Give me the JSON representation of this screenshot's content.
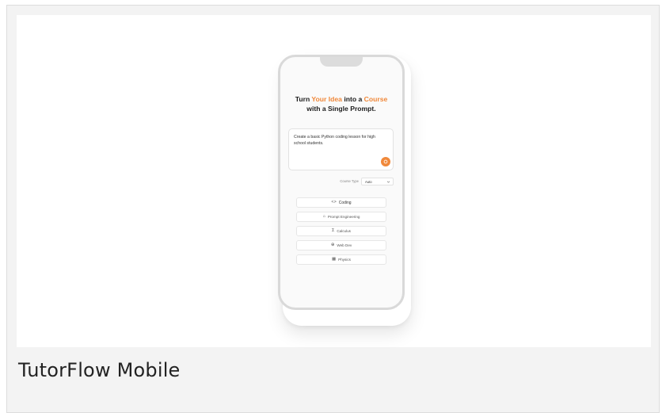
{
  "caption": "TutorFlow Mobile",
  "hero": {
    "line1_prefix": "Turn ",
    "line1_accent1": "Your Idea",
    "line1_mid": " into a ",
    "line1_accent2": "Course",
    "line2": "with a Single Prompt."
  },
  "prompt": {
    "text": "Create a basic Python coding lesson for high school students."
  },
  "course_type": {
    "label": "Course Type",
    "value": "Auto"
  },
  "categories": [
    {
      "label": "Coding",
      "icon": "code-icon",
      "glyph": "<>"
    },
    {
      "label": "Prompt Engineering",
      "icon": "robot-icon",
      "glyph": "⌂"
    },
    {
      "label": "Calculus",
      "icon": "sigma-icon",
      "glyph": "Σ"
    },
    {
      "label": "Web Dev",
      "icon": "globe-icon",
      "glyph": "⊕"
    },
    {
      "label": "Physics",
      "icon": "grid-icon",
      "glyph": "▦"
    }
  ],
  "colors": {
    "accent": "#f0883a",
    "background": "#f3f3f3",
    "phone_border": "#d9d9d9"
  }
}
